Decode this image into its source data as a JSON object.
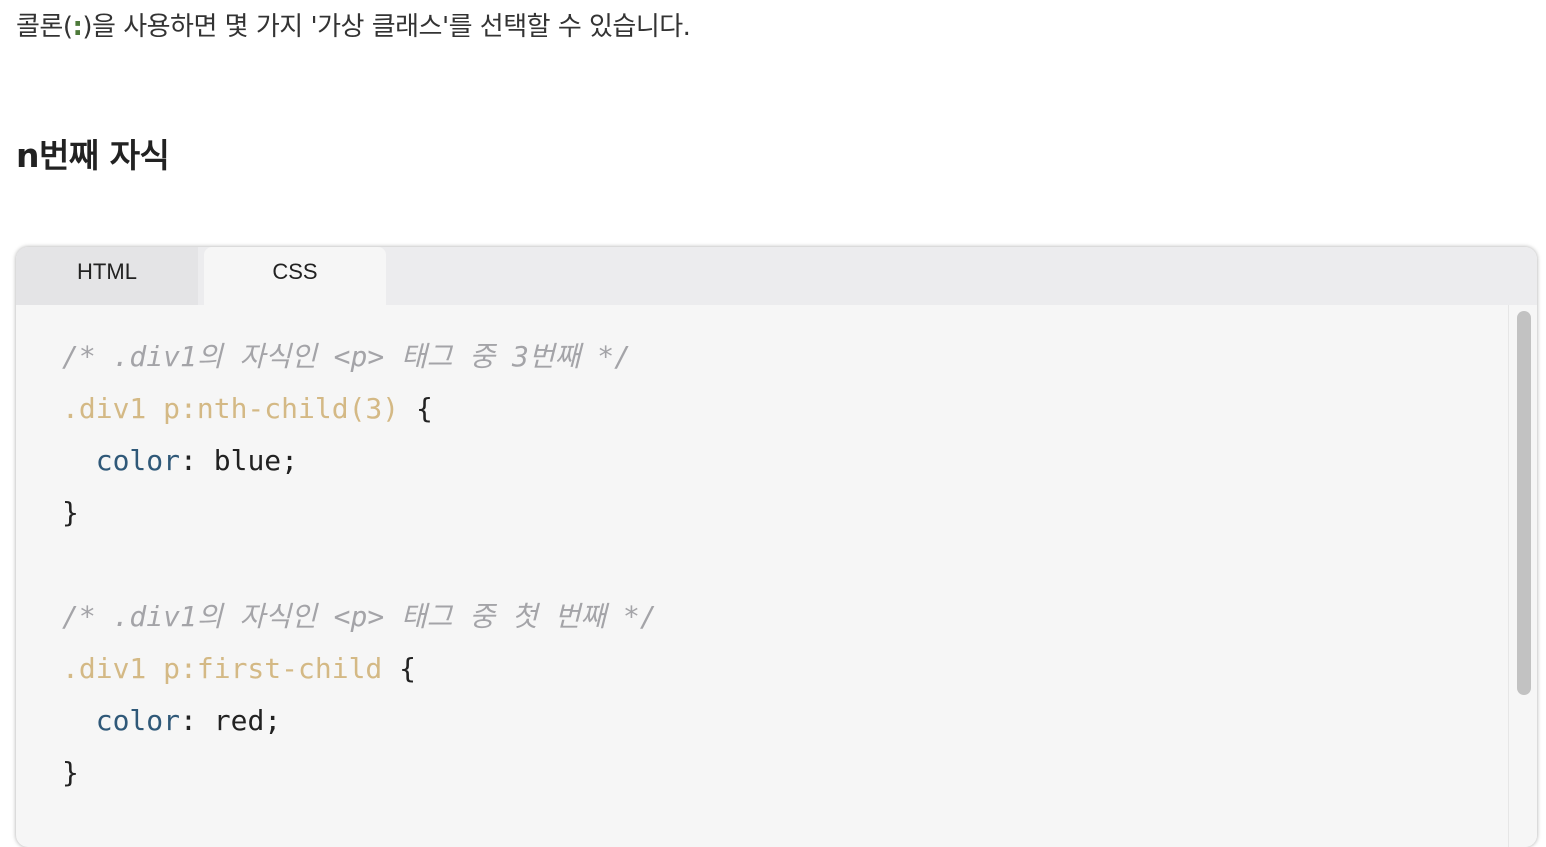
{
  "intro": {
    "before": "콜론(",
    "colon": ":",
    "after": ")을 사용하면 몇 가지 '가상 클래스'를 선택할 수 있습니다."
  },
  "heading": "n번째 자식",
  "editor": {
    "tabs": [
      {
        "label": "HTML",
        "active": false
      },
      {
        "label": "CSS",
        "active": true
      }
    ],
    "code": {
      "comment1": "/* .div1의 자식인 <p> 태그 중 3번째 */",
      "selector1": ".div1 p:nth-child(3)",
      "brace_open1": " {",
      "prop1": "color",
      "value1": ": blue;",
      "brace_close1": "}",
      "comment2": "/* .div1의 자식인 <p> 태그 중 첫 번째 */",
      "selector2": ".div1 p:first-child",
      "brace_open2": " {",
      "prop2": "color",
      "value2": ": red;",
      "brace_close2": "}"
    },
    "colors": {
      "comment": "#a4a4a8",
      "selector": "#d4b985",
      "property": "#2f5878",
      "colon_accent": "#4e7a3a"
    }
  }
}
